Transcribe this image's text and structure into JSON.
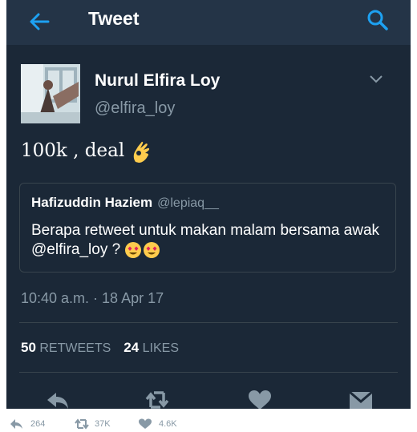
{
  "header": {
    "title": "Tweet",
    "back_icon": "arrow-left-icon",
    "search_icon": "search-icon",
    "accent": "#1da1f2"
  },
  "tweet": {
    "author_name": "Nurul Elfira Loy",
    "author_handle": "@elfira_loy",
    "text": "100k , deal",
    "emoji": "ok-hand-emoji",
    "timestamp": "10:40 a.m. · 18 Apr 17",
    "retweets_count": "50",
    "retweets_label": "RETWEETS",
    "likes_count": "24",
    "likes_label": "LIKES"
  },
  "quoted": {
    "name": "Hafizuddin Haziem",
    "handle": "@lepiaq__",
    "text": "Berapa retweet untuk makan malam bersama awak @elfira_loy ?",
    "emoji": "heart-eyes-emoji"
  },
  "actions": [
    "reply-icon",
    "retweet-icon",
    "like-icon",
    "message-icon"
  ],
  "footer": {
    "replies": "264",
    "retweets": "37K",
    "likes": "4.6K"
  }
}
